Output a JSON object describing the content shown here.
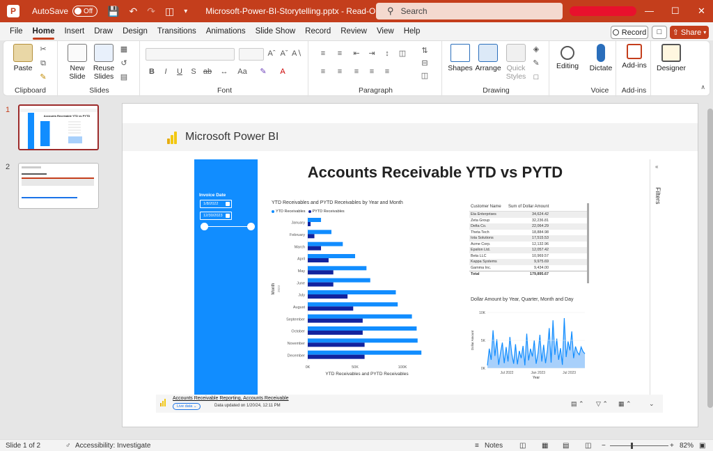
{
  "titlebar": {
    "autosave_label": "AutoSave",
    "autosave_state": "Off",
    "filename": "Microsoft-Power-BI-Storytelling.pptx  -  Read-O...  •  Saved  ∨",
    "search_placeholder": "Search"
  },
  "menu": {
    "tabs": [
      "File",
      "Home",
      "Insert",
      "Draw",
      "Design",
      "Transitions",
      "Animations",
      "Slide Show",
      "Record",
      "Review",
      "View",
      "Help"
    ],
    "active": "Home",
    "record_label": "Record",
    "share_label": "Share"
  },
  "ribbon": {
    "clipboard": {
      "paste": "Paste",
      "label": "Clipboard"
    },
    "slides": {
      "new_slide": "New Slide",
      "reuse_slides": "Reuse Slides",
      "label": "Slides"
    },
    "font": {
      "label": "Font"
    },
    "paragraph": {
      "label": "Paragraph"
    },
    "drawing": {
      "shapes": "Shapes",
      "arrange": "Arrange",
      "quick_styles": "Quick Styles",
      "label": "Drawing"
    },
    "editing": {
      "label": "Editing"
    },
    "voice": {
      "dictate": "Dictate",
      "label": "Voice"
    },
    "addins": {
      "addins": "Add-ins",
      "label": "Add-ins"
    },
    "designer": {
      "label": "Designer"
    }
  },
  "thumbnails": [
    {
      "num": "1",
      "title": "Accounts Receivable YTD vs PYTD"
    },
    {
      "num": "2",
      "title": ""
    }
  ],
  "slide": {
    "brand": "Microsoft Power BI",
    "report_title": "Accounts Receivable YTD vs PYTD",
    "filters_label": "Filters",
    "filter_panel": {
      "label": "Invoice Date",
      "start_date": "1/8/2022",
      "end_date": "12/30/2023"
    },
    "footer": {
      "link": "Accounts Receivable Reporting, Accounts Receivable",
      "live": "Live data",
      "updated": "Data updated on 1/20/24, 12:11 PM"
    }
  },
  "colors": {
    "ytd": "#118dff",
    "pytd": "#12239e",
    "accent": "#c43e1c"
  },
  "chart_data": [
    {
      "type": "bar",
      "orientation": "horizontal",
      "title": "YTD Receivables and PYTD Receivables by Year and Month",
      "xlabel": "YTD Receivables and PYTD Receivables",
      "ylabel": "Month",
      "ylabel_sub": "2023",
      "categories": [
        "January",
        "February",
        "March",
        "April",
        "May",
        "June",
        "July",
        "August",
        "September",
        "October",
        "November",
        "December"
      ],
      "series": [
        {
          "name": "YTD Receivables",
          "values": [
            14000,
            25000,
            37000,
            50000,
            62000,
            66000,
            93000,
            95000,
            110000,
            115000,
            116000,
            120000
          ]
        },
        {
          "name": "PYTD Receivables",
          "values": [
            3000,
            7000,
            14000,
            22000,
            27000,
            27000,
            42000,
            48000,
            58000,
            58000,
            60000,
            60000
          ]
        }
      ],
      "xticks": [
        "0K",
        "50K",
        "100K"
      ],
      "xlim": [
        0,
        125000
      ],
      "legend": "top-left"
    },
    {
      "type": "table",
      "columns": [
        "Customer Name",
        "Sum of Dollar Amount"
      ],
      "rows": [
        [
          "Eta Enterprises",
          "34,624.42"
        ],
        [
          "Zeta Group",
          "32,236.81"
        ],
        [
          "Delta Co.",
          "22,064.29"
        ],
        [
          "Theta Tech",
          "18,884.98"
        ],
        [
          "Iota Solutions",
          "17,515.53"
        ],
        [
          "Acme Corp.",
          "12,132.96"
        ],
        [
          "Epsilon Ltd.",
          "12,057.42"
        ],
        [
          "Beta LLC",
          "10,969.57"
        ],
        [
          "Kappa Systems",
          "9,975.69"
        ],
        [
          "Gamma Inc.",
          "9,434.00"
        ]
      ],
      "total": [
        "Total",
        "179,895.67"
      ]
    },
    {
      "type": "area",
      "title": "Dollar Amount by Year, Quarter, Month and Day",
      "xlabel": "Year",
      "ylabel": "Dollar Amount",
      "yticks": [
        "0K",
        "5K",
        "10K"
      ],
      "xticks": [
        "Jul 2022",
        "Jan 2023",
        "Jul 2023"
      ],
      "ylim": [
        0,
        10000
      ],
      "values": [
        500,
        3500,
        1500,
        6800,
        2200,
        5200,
        600,
        2800,
        4600,
        900,
        3800,
        1200,
        5600,
        2600,
        800,
        4300,
        700,
        3100,
        1800,
        4000,
        500,
        6200,
        1400,
        3500,
        2100,
        5000,
        800,
        2700,
        6000,
        1200,
        4200,
        900,
        3300,
        7200,
        1000,
        8600,
        2400,
        5300,
        1500,
        3600,
        600,
        9000,
        2000,
        4800,
        3200,
        6600,
        1800,
        3900,
        2900,
        2400,
        3800,
        3000,
        2600
      ]
    }
  ],
  "status": {
    "slide": "Slide 1 of 2",
    "accessibility": "Accessibility: Investigate",
    "notes": "Notes",
    "zoom": "82%"
  }
}
